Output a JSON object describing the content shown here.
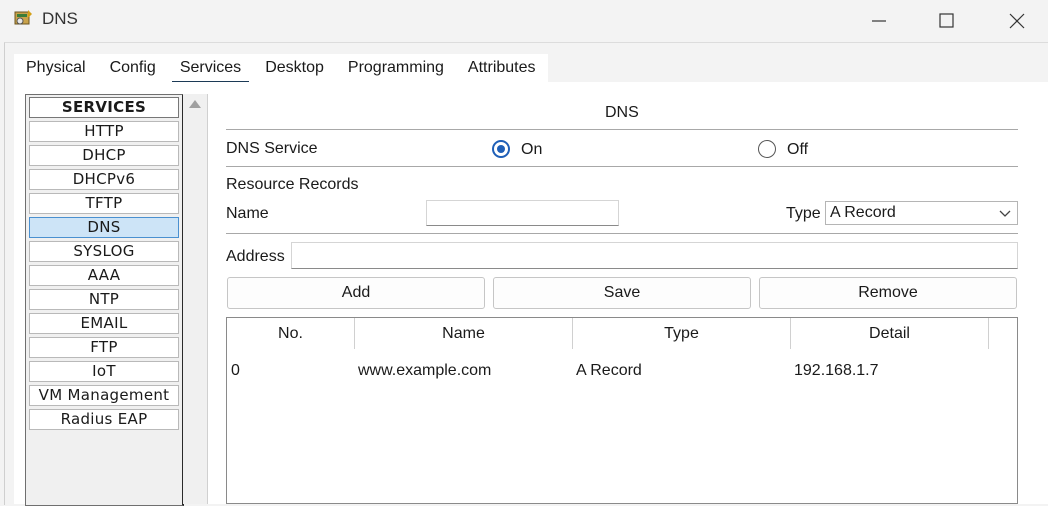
{
  "window": {
    "title": "DNS"
  },
  "tabs": [
    "Physical",
    "Config",
    "Services",
    "Desktop",
    "Programming",
    "Attributes"
  ],
  "active_tab": "Services",
  "services": {
    "header": "SERVICES",
    "items": [
      "HTTP",
      "DHCP",
      "DHCPv6",
      "TFTP",
      "DNS",
      "SYSLOG",
      "AAA",
      "NTP",
      "EMAIL",
      "FTP",
      "IoT",
      "VM Management",
      "Radius EAP"
    ],
    "selected": "DNS"
  },
  "dns": {
    "section_title": "DNS",
    "service_label": "DNS Service",
    "on_label": "On",
    "off_label": "Off",
    "service_state": "On",
    "resource_records_label": "Resource Records",
    "name_label": "Name",
    "name_value": "",
    "type_label": "Type",
    "type_value": "A Record",
    "address_label": "Address",
    "address_value": "",
    "buttons": {
      "add": "Add",
      "save": "Save",
      "remove": "Remove"
    },
    "table": {
      "columns": [
        "No.",
        "Name",
        "Type",
        "Detail"
      ],
      "rows": [
        {
          "no": "0",
          "name": "www.example.com",
          "type": "A Record",
          "detail": "192.168.1.7"
        }
      ]
    }
  }
}
